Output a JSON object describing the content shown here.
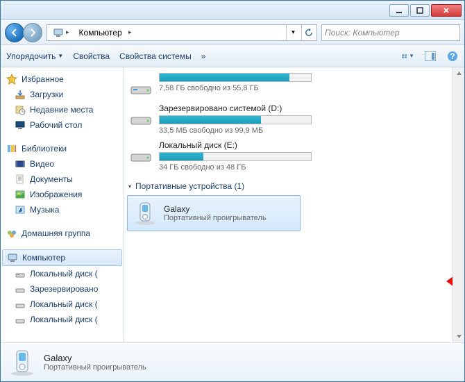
{
  "breadcrumb": {
    "root_icon": "computer-icon",
    "segments": [
      "Компьютер"
    ]
  },
  "search": {
    "placeholder": "Поиск: Компьютер"
  },
  "toolbar": {
    "organize": "Упорядочить",
    "properties": "Свойства",
    "sysprops": "Свойства системы",
    "overflow": "»"
  },
  "sidebar": {
    "favorites": {
      "label": "Избранное",
      "items": [
        "Загрузки",
        "Недавние места",
        "Рабочий стол"
      ]
    },
    "libraries": {
      "label": "Библиотеки",
      "items": [
        "Видео",
        "Документы",
        "Изображения",
        "Музыка"
      ]
    },
    "homegroup": {
      "label": "Домашняя группа"
    },
    "computer": {
      "label": "Компьютер",
      "items": [
        "Локальный диск (",
        "Зарезервировано",
        "Локальный диск (",
        "Локальный диск ("
      ]
    }
  },
  "drives": [
    {
      "name": "",
      "free": "7,58 ГБ свободно из 55,8 ГБ",
      "fill": 86
    },
    {
      "name": "Зарезервировано системой (D:)",
      "free": "33,5 МБ свободно из 99,9 МБ",
      "fill": 67
    },
    {
      "name": "Локальный диск (E:)",
      "free": "34 ГБ   свободно из 48 ГБ",
      "fill": 29
    }
  ],
  "portable": {
    "header": "Портативные устройства (1)",
    "device_name": "Galaxy",
    "device_sub": "Портативный проигрыватель"
  },
  "details": {
    "name": "Galaxy",
    "sub": "Портативный проигрыватель"
  }
}
